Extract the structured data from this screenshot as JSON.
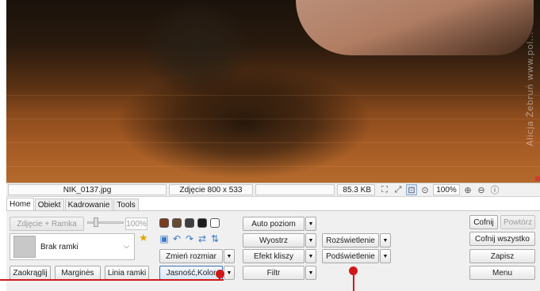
{
  "photo": {
    "watermark": "Alicja Żebruń www.pol...",
    "description_hidden": ""
  },
  "statusbar": {
    "filename": "NIK_0137.jpg",
    "dimensions": "Zdjęcie 800 x 533",
    "blank": "",
    "file_size": "85.3 KB",
    "zoom": "100%",
    "icons": [
      "fit-screen-icon",
      "actual-size-icon",
      "zoom-select-icon",
      "zoom-fit-icon",
      "zoom-in-icon",
      "zoom-out-icon",
      "info-icon"
    ]
  },
  "tabs": [
    {
      "label": "Home",
      "active": true
    },
    {
      "label": "Obiekt",
      "active": false
    },
    {
      "label": "Kadrowanie",
      "active": false
    },
    {
      "label": "Tools",
      "active": false
    }
  ],
  "frame_group": {
    "photo_frame_label": "Zdjęcie + Ramka",
    "slider_value": "100%",
    "frame_select_value": "Brak ramki",
    "rounded_label": "Zaokrąglij",
    "margins_label": "Marginės",
    "frame_line_label": "Linia ramki"
  },
  "edit_group": {
    "swatches": [
      "#7a3b1e",
      "#6b4a34",
      "#3e3e3e",
      "#1c1c1c",
      "#ffffff"
    ],
    "resize_label": "Zmień rozmiar",
    "brightness_label": "Jasność,Kolor"
  },
  "filter_group": {
    "auto_level_label": "Auto poziom",
    "sharpen_label": "Wyostrz",
    "film_effect_label": "Efekt kliszy",
    "filter_label": "Filtr"
  },
  "light_group": {
    "brighten_label": "Rozświetlenie",
    "backlight_label": "Podświetlenie"
  },
  "actions": {
    "undo_label": "Cofnij",
    "redo_label": "Powtórz",
    "undo_all_label": "Cofnij wszystko",
    "save_label": "Zapisz",
    "menu_label": "Menu"
  },
  "colors": {
    "callout": "#d01818",
    "accent": "#3c6fb3"
  }
}
